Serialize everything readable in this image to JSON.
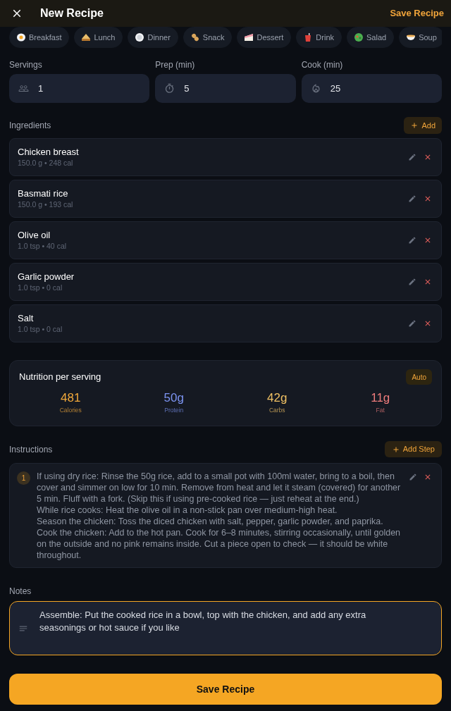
{
  "header": {
    "title": "New Recipe",
    "action": "Save Recipe"
  },
  "categories": [
    {
      "label": "Breakfast",
      "kind": "egg",
      "selected": false
    },
    {
      "label": "Lunch",
      "kind": "sandwich",
      "selected": false
    },
    {
      "label": "Dinner",
      "kind": "plate",
      "selected": false
    },
    {
      "label": "Snack",
      "kind": "peanut",
      "selected": false
    },
    {
      "label": "Dessert",
      "kind": "cake",
      "selected": false
    },
    {
      "label": "Drink",
      "kind": "drink",
      "selected": false
    },
    {
      "label": "Salad",
      "kind": "salad",
      "selected": false
    },
    {
      "label": "Soup",
      "kind": "soup",
      "selected": false
    }
  ],
  "meta_fields": [
    {
      "label": "Servings",
      "kind": "servings",
      "value": "1"
    },
    {
      "label": "Prep (min)",
      "kind": "timer",
      "value": "5"
    },
    {
      "label": "Cook (min)",
      "kind": "flame",
      "value": "25"
    }
  ],
  "ingredients": {
    "title": "Ingredients",
    "add_button": "Add",
    "items": [
      {
        "name": "Chicken breast",
        "detail": "150.0 g • 248 cal"
      },
      {
        "name": "Basmati rice",
        "detail": "150.0 g • 193 cal"
      },
      {
        "name": "Olive oil",
        "detail": "1.0 tsp • 40 cal"
      },
      {
        "name": "Garlic powder",
        "detail": "1.0 tsp • 0 cal"
      },
      {
        "name": "Salt",
        "detail": "1.0 tsp • 0 cal"
      }
    ]
  },
  "nutrition": {
    "title": "Nutrition per serving",
    "badge": "Auto",
    "stats": [
      {
        "value": "481",
        "label": "Calories",
        "color": "#f2a93b"
      },
      {
        "value": "50g",
        "label": "Protein",
        "color": "#7c94f2"
      },
      {
        "value": "42g",
        "label": "Carbs",
        "color": "#efc063"
      },
      {
        "value": "11g",
        "label": "Fat",
        "color": "#ee7c7c"
      }
    ]
  },
  "instructions": {
    "title": "Instructions",
    "add_button": "Add Step",
    "steps": [
      {
        "number": "1",
        "paragraphs": [
          "If using dry rice: Rinse the 50g rice, add to a small pot with 100ml water, bring to a boil, then cover and simmer on low for 10 min. Remove from heat and let it steam (covered) for another 5 min. Fluff with a fork. (Skip this if using pre-cooked rice — just reheat at the end.)",
          "While rice cooks: Heat the olive oil in a non-stick pan over medium-high heat.",
          "Season the chicken: Toss the diced chicken with salt, pepper, garlic powder, and paprika.",
          "Cook the chicken: Add to the hot pan. Cook for 6–8 minutes, stirring occasionally, until golden on the outside and no pink remains inside. Cut a piece open to check — it should be white throughout."
        ]
      }
    ]
  },
  "notes": {
    "label": "Notes",
    "value": "Assemble: Put the cooked rice in a bowl, top with the chicken, and add any extra seasonings or hot sauce if you like"
  },
  "save_button": "Save Recipe"
}
